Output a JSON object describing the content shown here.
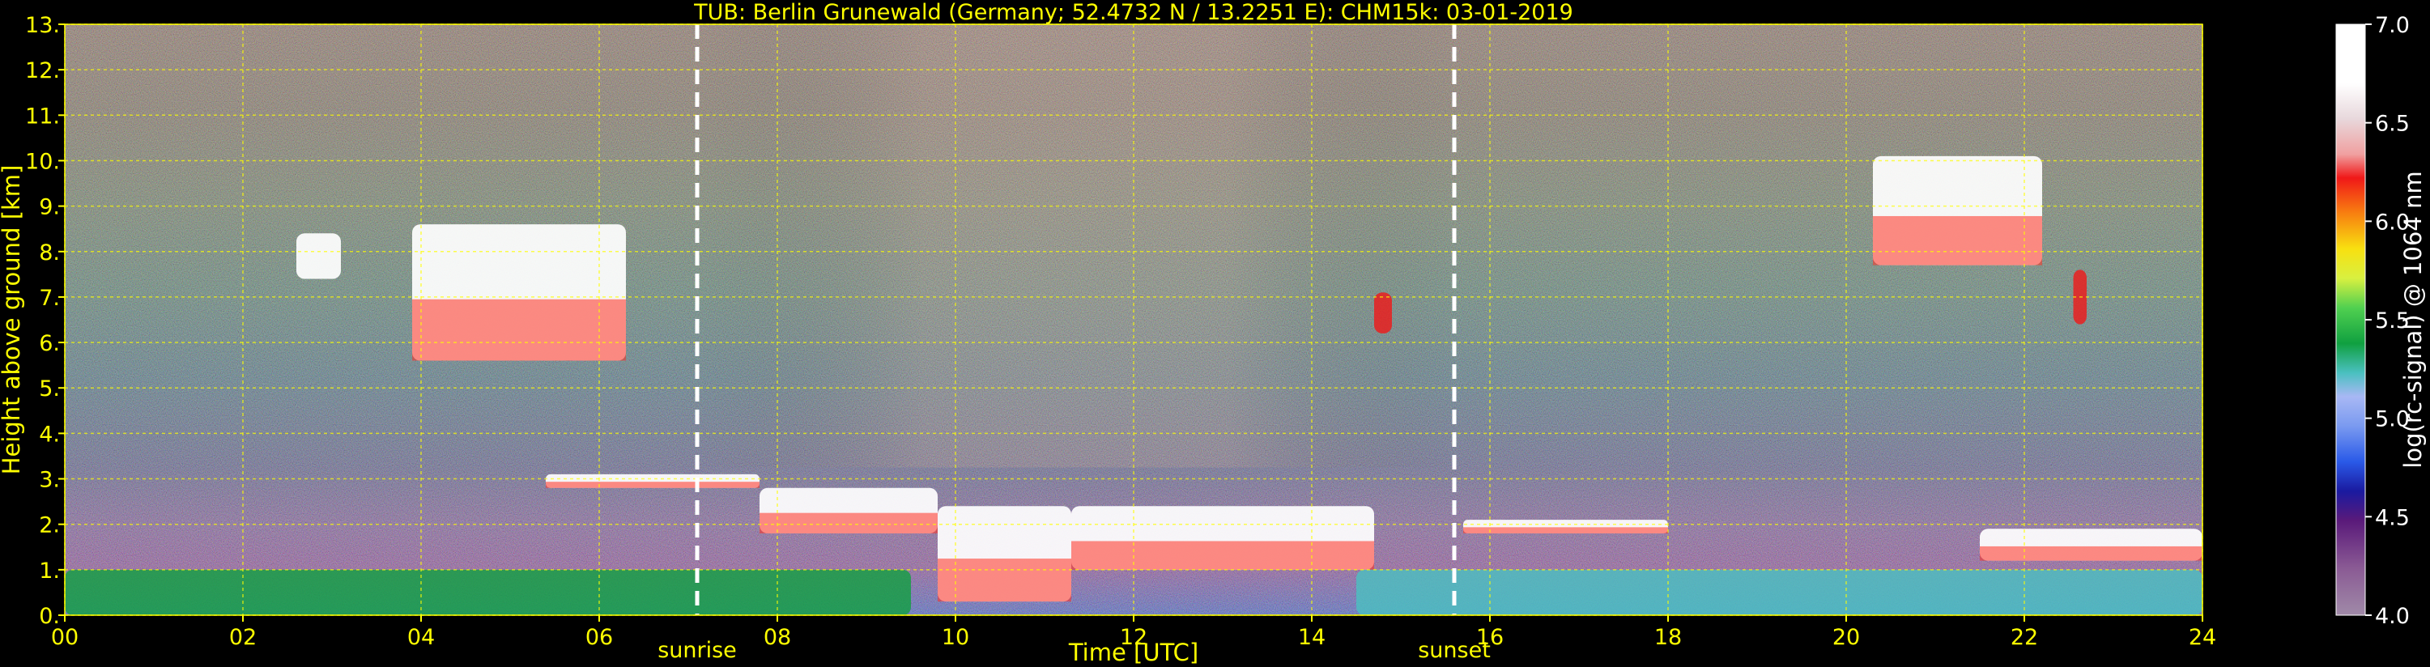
{
  "chart_data": {
    "type": "heatmap",
    "title": "TUB: Berlin Grunewald (Germany; 52.4732 N / 13.2251 E):    CHM15k: 03-01-2019",
    "xlabel": "Time [UTC]",
    "ylabel": "Height above ground [km]",
    "xlim": [
      0,
      24
    ],
    "ylim": [
      0,
      13
    ],
    "x_ticks": [
      "00",
      "02",
      "04",
      "06",
      "08",
      "10",
      "12",
      "14",
      "16",
      "18",
      "20",
      "22",
      "24"
    ],
    "y_ticks": [
      "0.",
      "1.",
      "2.",
      "3.",
      "4.",
      "5.",
      "6.",
      "7.",
      "8.",
      "9.",
      "10.",
      "11.",
      "12.",
      "13."
    ],
    "grid": true,
    "markers": [
      {
        "label": "sunrise",
        "time": 7.1
      },
      {
        "label": "sunset",
        "time": 15.6
      }
    ],
    "colorbar": {
      "label": "log(rc-signal) @ 1064 nm",
      "range": [
        4.0,
        7.0
      ],
      "ticks": [
        "4.0",
        "4.5",
        "5.0",
        "5.5",
        "6.0",
        "6.5",
        "7.0"
      ]
    },
    "features": [
      {
        "name": "high cloud",
        "t_start": 2.6,
        "t_end": 3.1,
        "h_bottom": 7.4,
        "h_top": 8.4,
        "signal": 6.5
      },
      {
        "name": "high cloud",
        "t_start": 3.9,
        "t_end": 6.3,
        "h_bottom": 5.6,
        "h_top": 8.6,
        "signal": 6.8
      },
      {
        "name": "mid cloud",
        "t_start": 14.7,
        "t_end": 14.9,
        "h_bottom": 6.2,
        "h_top": 7.1,
        "signal": 6.0
      },
      {
        "name": "high cloud",
        "t_start": 20.3,
        "t_end": 22.2,
        "h_bottom": 7.7,
        "h_top": 10.1,
        "signal": 6.8
      },
      {
        "name": "mid cloud",
        "t_start": 22.55,
        "t_end": 22.7,
        "h_bottom": 6.4,
        "h_top": 7.6,
        "signal": 6.0
      },
      {
        "name": "boundary-layer top",
        "t_start": 5.4,
        "t_end": 7.8,
        "h_bottom": 2.8,
        "h_top": 3.1,
        "signal": 7.0
      },
      {
        "name": "low cloud",
        "t_start": 7.8,
        "t_end": 9.8,
        "h_bottom": 1.8,
        "h_top": 2.8,
        "signal": 6.9
      },
      {
        "name": "low cloud",
        "t_start": 9.8,
        "t_end": 11.3,
        "h_bottom": 0.3,
        "h_top": 2.4,
        "signal": 6.9
      },
      {
        "name": "low cloud",
        "t_start": 11.3,
        "t_end": 14.7,
        "h_bottom": 1.0,
        "h_top": 2.4,
        "signal": 6.9
      },
      {
        "name": "low cloud",
        "t_start": 15.7,
        "t_end": 18.0,
        "h_bottom": 1.8,
        "h_top": 2.1,
        "signal": 6.8
      },
      {
        "name": "low cloud",
        "t_start": 21.5,
        "t_end": 24.0,
        "h_bottom": 1.2,
        "h_top": 1.9,
        "signal": 6.8
      },
      {
        "name": "aerosol layer",
        "t_start": 0.0,
        "t_end": 9.5,
        "h_bottom": 0.0,
        "h_top": 1.0,
        "signal": 5.1
      },
      {
        "name": "aerosol layer",
        "t_start": 14.5,
        "t_end": 24.0,
        "h_bottom": 0.0,
        "h_top": 1.0,
        "signal": 4.6
      }
    ]
  }
}
